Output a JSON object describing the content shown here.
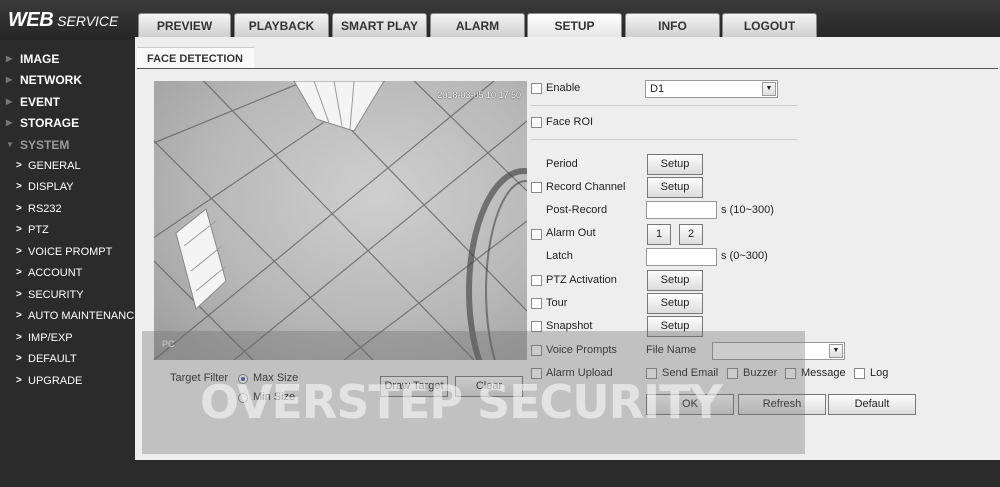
{
  "header": {
    "logo_main": "WEB",
    "logo_sub": "SERVICE"
  },
  "tabs": [
    {
      "label": "PREVIEW"
    },
    {
      "label": "PLAYBACK"
    },
    {
      "label": "SMART PLAY"
    },
    {
      "label": "ALARM"
    },
    {
      "label": "SETUP",
      "active": true
    },
    {
      "label": "INFO"
    },
    {
      "label": "LOGOUT"
    }
  ],
  "sidebar": {
    "menu": [
      {
        "label": "IMAGE"
      },
      {
        "label": "NETWORK"
      },
      {
        "label": "EVENT"
      },
      {
        "label": "STORAGE"
      },
      {
        "label": "SYSTEM",
        "expanded": true
      }
    ],
    "system_items": [
      {
        "label": "GENERAL"
      },
      {
        "label": "DISPLAY"
      },
      {
        "label": "RS232"
      },
      {
        "label": "PTZ"
      },
      {
        "label": "VOICE PROMPT"
      },
      {
        "label": "ACCOUNT"
      },
      {
        "label": "SECURITY"
      },
      {
        "label": "AUTO MAINTENANCE"
      },
      {
        "label": "IMP/EXP"
      },
      {
        "label": "DEFAULT"
      },
      {
        "label": "UPGRADE"
      }
    ]
  },
  "page": {
    "section_title": "FACE DETECTION"
  },
  "video": {
    "timestamp": "2018-03-05 10:17:50",
    "channel_name": "PC"
  },
  "form": {
    "enable_label": "Enable",
    "channel_value": "D1",
    "face_roi_label": "Face ROI",
    "period_label": "Period",
    "setup_label": "Setup",
    "record_channel_label": "Record Channel",
    "post_record_label": "Post-Record",
    "post_record_value": "",
    "post_record_unit": "s (10~300)",
    "alarm_out_label": "Alarm Out",
    "alarm_out_1": "1",
    "alarm_out_2": "2",
    "latch_label": "Latch",
    "latch_value": "",
    "latch_unit": "s (0~300)",
    "ptz_label": "PTZ Activation",
    "tour_label": "Tour",
    "snapshot_label": "Snapshot",
    "voice_label": "Voice Prompts",
    "file_name_label": "File Name",
    "file_name_value": "",
    "alarm_upload_label": "Alarm Upload",
    "send_email_label": "Send Email",
    "buzzer_label": "Buzzer",
    "message_label": "Message",
    "log_label": "Log"
  },
  "target": {
    "filter_label": "Target Filter",
    "max_size_label": "Max Size",
    "min_size_label": "Min Size",
    "draw_target_label": "Draw Target",
    "clear_label": "Clear"
  },
  "actions": {
    "ok_label": "OK",
    "refresh_label": "Refresh",
    "default_label": "Default"
  },
  "watermark": {
    "text": "OVERSTEP SECURITY"
  }
}
